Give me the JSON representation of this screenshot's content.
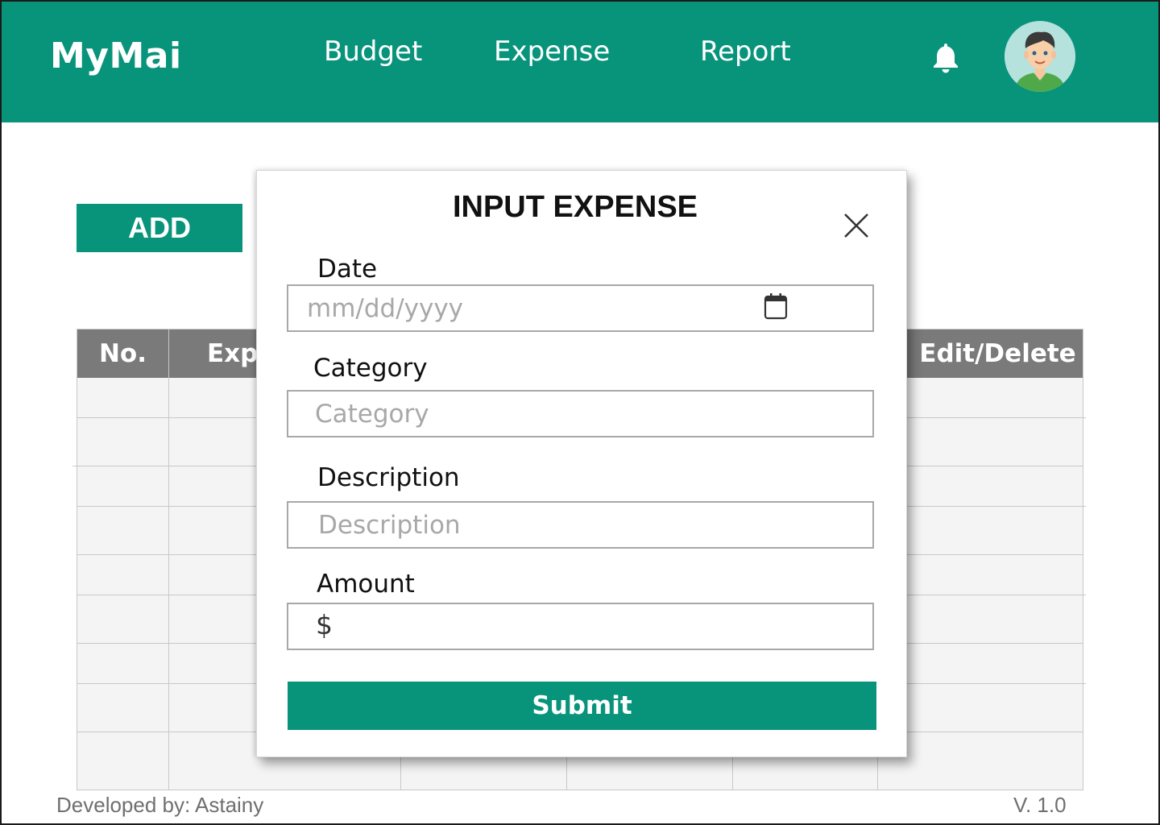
{
  "app": {
    "logo": "MyMai"
  },
  "nav": {
    "budget": "Budget",
    "expense": "Expense",
    "report": "Report"
  },
  "header": {
    "notification_icon": "bell-icon",
    "avatar_icon": "user-avatar"
  },
  "main": {
    "add_label": "ADD"
  },
  "table": {
    "columns": [
      "No.",
      "Expe",
      "Edit/Delete"
    ]
  },
  "modal": {
    "title": "INPUT EXPENSE",
    "close_icon": "close-icon",
    "date": {
      "label": "Date",
      "placeholder": "mm/dd/yyyy",
      "icon": "calendar-icon"
    },
    "category": {
      "label": "Category",
      "placeholder": "Category"
    },
    "description": {
      "label": "Description",
      "placeholder": "Description"
    },
    "amount": {
      "label": "Amount",
      "prefix": "$",
      "value": ""
    },
    "submit_label": "Submit"
  },
  "footer": {
    "developer": "Developed by: Astainy",
    "version": "V. 1.0"
  },
  "colors": {
    "brand": "#08937b",
    "table_header": "#7a7a7a",
    "table_body": "#f4f4f4"
  }
}
